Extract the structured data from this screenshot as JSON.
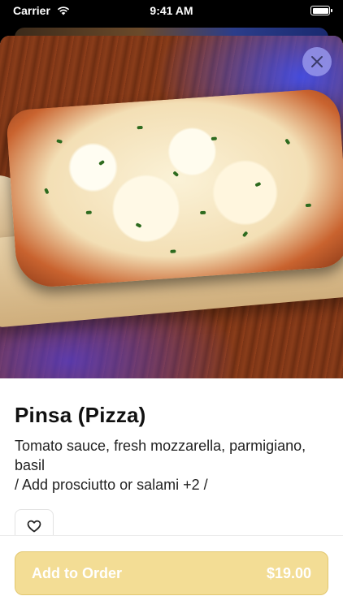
{
  "status_bar": {
    "carrier": "Carrier",
    "time": "9:41 AM"
  },
  "item": {
    "name": "Pinsa (Pizza)",
    "description_lines": [
      "Tomato sauce, fresh mozzarella, parmigiano,",
      "basil",
      "/ Add prosciutto or salami +2 /"
    ]
  },
  "actions": {
    "add_label": "Add to Order",
    "price": "$19.00"
  },
  "colors": {
    "add_button": "#f3dd95",
    "close_button": "#9696eb"
  }
}
